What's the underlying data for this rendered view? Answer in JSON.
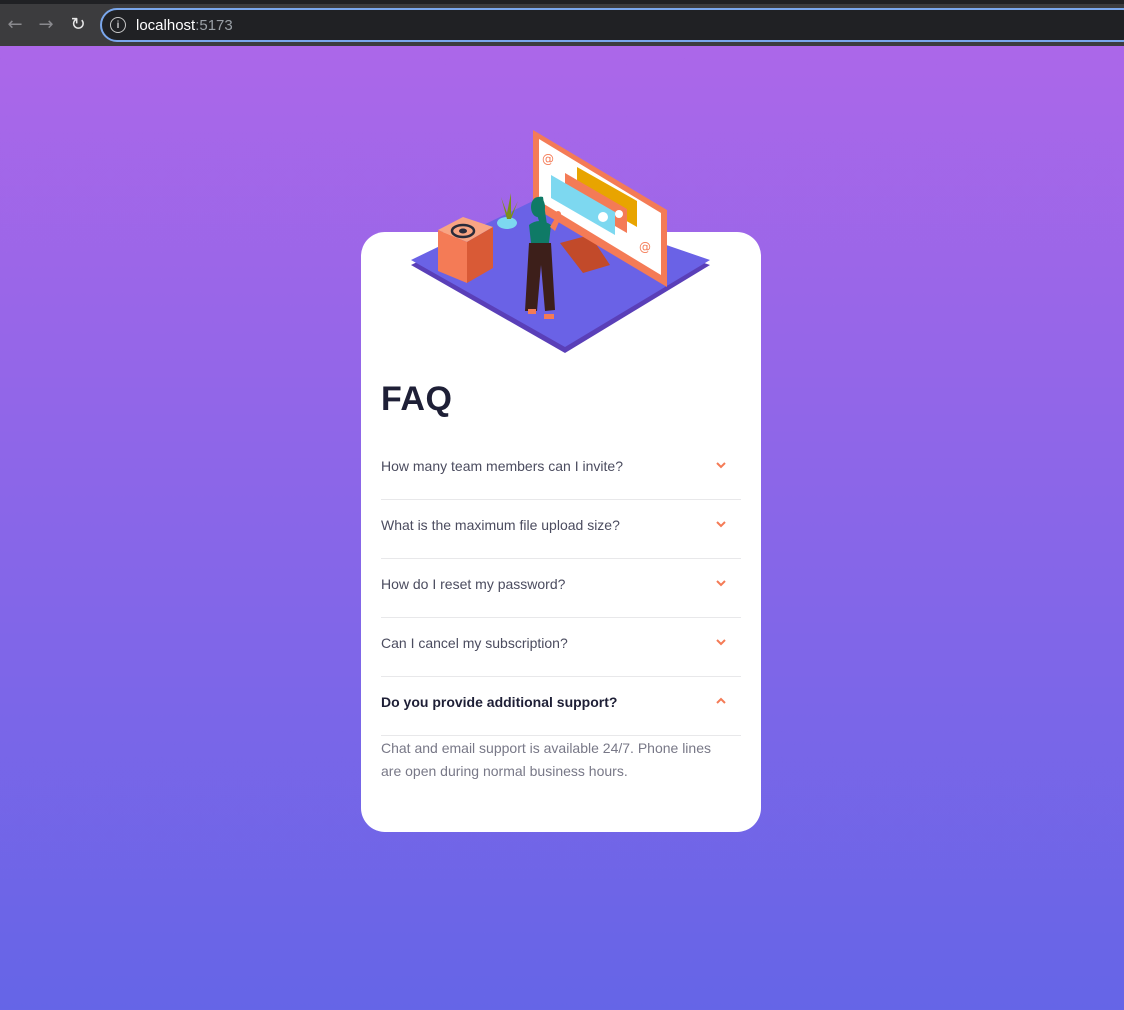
{
  "browser": {
    "url_host": "localhost",
    "url_port": ":5173",
    "back_icon": "arrow-left-icon",
    "forward_icon": "arrow-right-icon",
    "reload_icon": "reload-icon",
    "site_info_icon": "info-icon"
  },
  "colors": {
    "background_top": "#af67e9",
    "background_bottom": "#6565e7",
    "accent": "#f47b56",
    "title": "#1e1f36"
  },
  "faq": {
    "title": "FAQ",
    "items": [
      {
        "question": "How many team members can I invite?",
        "open": false,
        "icon": "chevron-down-icon"
      },
      {
        "question": "What is the maximum file upload size?",
        "open": false,
        "icon": "chevron-down-icon"
      },
      {
        "question": "How do I reset my password?",
        "open": false,
        "icon": "chevron-down-icon"
      },
      {
        "question": "Can I cancel my subscription?",
        "open": false,
        "icon": "chevron-down-icon"
      },
      {
        "question": "Do you provide additional support?",
        "open": true,
        "icon": "chevron-up-icon"
      }
    ],
    "open_answer": "Chat and email support is available 24/7. Phone lines are open during normal business hours."
  }
}
